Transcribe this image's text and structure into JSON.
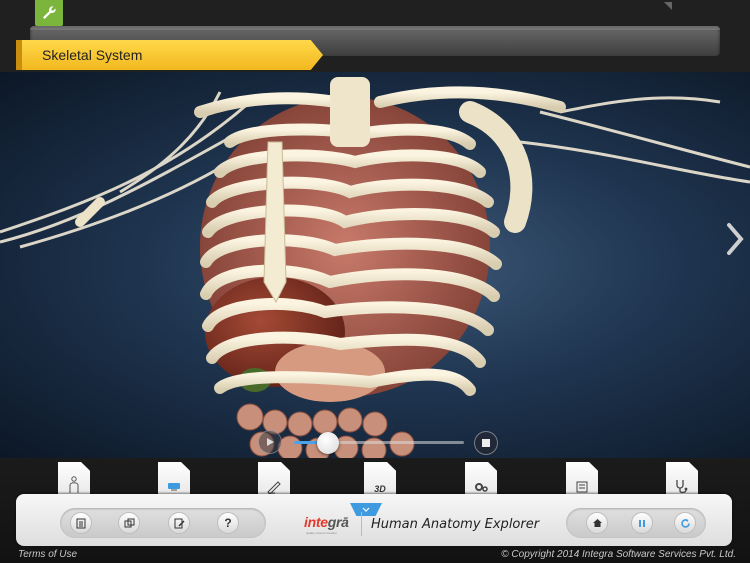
{
  "header": {
    "title": "Skeletal System",
    "settings_icon": "wrench-icon",
    "accent_color": "#7cb53c",
    "banner_color": "#f7c52f"
  },
  "viewer": {
    "subject": "3D human anatomy model — rib cage, spine, clavicles and abdominal organs",
    "next_icon": "chevron-right-icon",
    "playback": {
      "play_icon": "play-icon",
      "stop_icon": "stop-icon",
      "progress": 0.2
    }
  },
  "toolbar": {
    "tabs": [
      {
        "name": "tab-body",
        "icon": "body-outline-icon",
        "label": ""
      },
      {
        "name": "tab-quiz",
        "icon": "quiz-icon",
        "label": ""
      },
      {
        "name": "tab-notes",
        "icon": "pen-icon",
        "label": ""
      },
      {
        "name": "tab-3d",
        "icon": "3d-icon",
        "label": "3D"
      },
      {
        "name": "tab-settings",
        "icon": "gears-icon",
        "label": ""
      },
      {
        "name": "tab-report",
        "icon": "report-icon",
        "label": ""
      },
      {
        "name": "tab-stethoscope",
        "icon": "stethoscope-icon",
        "label": ""
      }
    ],
    "left_buttons": [
      {
        "name": "list-button",
        "icon": "list-icon",
        "label": ""
      },
      {
        "name": "copy-button",
        "icon": "copy-icon",
        "label": ""
      },
      {
        "name": "edit-button",
        "icon": "edit-icon",
        "label": ""
      },
      {
        "name": "help-button",
        "icon": "help-icon",
        "label": "?"
      }
    ],
    "right_buttons": [
      {
        "name": "home-button",
        "icon": "home-icon"
      },
      {
        "name": "pause-button",
        "icon": "pause-icon"
      },
      {
        "name": "refresh-button",
        "icon": "refresh-icon"
      }
    ],
    "collapse_icon": "chevron-down-icon",
    "brand": {
      "logo_main": "inte",
      "logo_accent": "grā",
      "tagline": "quality content creation"
    },
    "app_name": "Human Anatomy Explorer"
  },
  "footer": {
    "terms": "Terms of Use",
    "copyright": "© Copyright 2014 Integra Software Services Pvt. Ltd."
  }
}
